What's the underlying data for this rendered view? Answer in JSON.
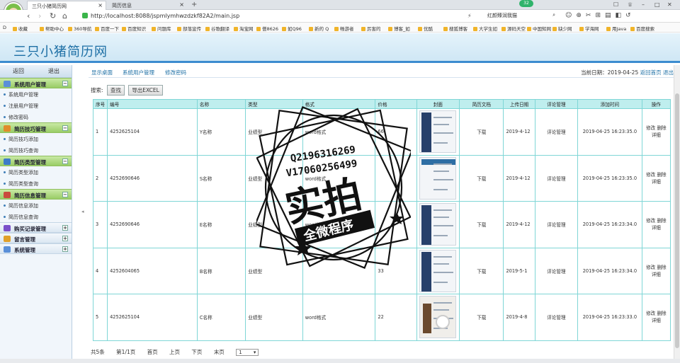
{
  "browser": {
    "tabs": [
      {
        "label": "三只小猪简历网",
        "active": true
      },
      {
        "label": "简历信息",
        "active": false
      }
    ],
    "badge": "32",
    "url": "http://localhost:8088/jspmlymhwzdzkf82A2/main.jsp",
    "search_value": "红颜臻润我猫",
    "bookmarks": [
      "收藏",
      "帮助中心",
      "360导航",
      "百度一下",
      "百度知识",
      "问题库",
      "部落宣传",
      "谷歌翻译",
      "淘宝网",
      "僧8626",
      "如Q96",
      "新的 Q",
      "畅游者",
      "厉害的",
      "博客_如",
      "优酷",
      "搜狐博客",
      "大学生如",
      "源码天空",
      "中国知网",
      "缺少网",
      "学海网",
      "用Java",
      "百度搜索"
    ]
  },
  "app": {
    "title": "三只小猪简历网"
  },
  "sidebar": {
    "back_label": "返回",
    "logout_label": "退出",
    "groups": [
      {
        "label": "系统用户管理",
        "color": "#5a8fd8",
        "open": true,
        "items": [
          "系统用户管理",
          "注册用户管理",
          "修改密码"
        ]
      },
      {
        "label": "简历技巧管理",
        "color": "#e08c2a",
        "open": true,
        "items": [
          "简历技巧添加",
          "简历技巧查询"
        ]
      },
      {
        "label": "简历类型管理",
        "color": "#3d7cc9",
        "open": true,
        "items": [
          "简历类型添加",
          "简历类型查询"
        ]
      },
      {
        "label": "简历信息管理",
        "color": "#c94a3d",
        "open": true,
        "items": [
          "简历信息添加",
          "简历信息查询"
        ]
      },
      {
        "label": "购买记录管理",
        "color": "#7a4fc9",
        "open": false,
        "items": []
      },
      {
        "label": "留言管理",
        "color": "#e0a02a",
        "open": false,
        "items": []
      },
      {
        "label": "系统管理",
        "color": "#5a8fd8",
        "open": false,
        "items": []
      }
    ]
  },
  "breadcrumb": {
    "items": [
      "显示桌面",
      "系统用户管理",
      "修改密码"
    ],
    "date_label": "当前日期：2019-04-25",
    "home_link": "返回首页",
    "exit_link": "退出"
  },
  "search": {
    "label": "搜索:",
    "find_button": "查找",
    "export_button": "导出EXCEL"
  },
  "table": {
    "headers": [
      "序号",
      "编号",
      "名称",
      "类型",
      "格式",
      "价格",
      "封面",
      "简历文档",
      "上传日期",
      "评论管理",
      "添加时间",
      "操作"
    ],
    "rows": [
      {
        "no": "1",
        "code": "4252625104",
        "name": "Y名称",
        "type": "业绩型",
        "format": "word格式",
        "price": "66",
        "doc": "下载",
        "date": "2019-4-12",
        "comment": "评论管理",
        "added": "2019-04-25 16:23:35.0",
        "edit": "修改",
        "del": "删除",
        "detail": "详细"
      },
      {
        "no": "2",
        "code": "4252690646",
        "name": "S名称",
        "type": "业绩型",
        "format": "word格式",
        "price": "",
        "doc": "下载",
        "date": "2019-4-12",
        "comment": "评论管理",
        "added": "2019-04-25 16:23:35.0",
        "edit": "修改",
        "del": "删除",
        "detail": "详细"
      },
      {
        "no": "3",
        "code": "4252690646",
        "name": "E名称",
        "type": "业绩型",
        "format": "word格式",
        "price": "",
        "doc": "下载",
        "date": "2019-4-12",
        "comment": "评论管理",
        "added": "2019-04-25 16:23:34.0",
        "edit": "修改",
        "del": "删除",
        "detail": "详细"
      },
      {
        "no": "4",
        "code": "4252604065",
        "name": "B名称",
        "type": "业绩型",
        "format": "",
        "price": "33",
        "doc": "下载",
        "date": "2019-5-1",
        "comment": "评论管理",
        "added": "2019-04-25 16:23:34.0",
        "edit": "修改",
        "del": "删除",
        "detail": "详细"
      },
      {
        "no": "5",
        "code": "4252625104",
        "name": "C名称",
        "type": "业绩型",
        "format": "word格式",
        "price": "22",
        "doc": "下载",
        "date": "2019-4-8",
        "comment": "评论管理",
        "added": "2019-04-25 16:23:33.0",
        "edit": "修改",
        "del": "删除",
        "detail": "详细"
      }
    ]
  },
  "pager": {
    "total": "共5条",
    "page": "第1/1页",
    "first": "首页",
    "prev": "上页",
    "next": "下页",
    "last": "末页",
    "selected": "1"
  },
  "stamp": {
    "line1": "Q2196316269",
    "line2": "V17060256499",
    "big": "实拍",
    "banner": "全微程序"
  }
}
